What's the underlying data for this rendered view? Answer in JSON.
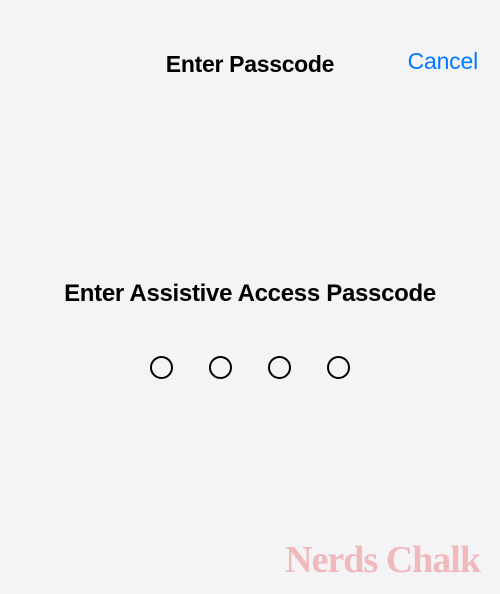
{
  "navbar": {
    "title": "Enter Passcode",
    "cancel_label": "Cancel"
  },
  "content": {
    "prompt": "Enter Assistive Access Passcode",
    "passcode_length": 4,
    "filled_count": 0
  },
  "watermark": {
    "text": "Nerds Chalk"
  },
  "colors": {
    "background": "#f4f3f6",
    "accent": "#007aff",
    "text": "#000000",
    "watermark": "rgba(236, 138, 142, 0.55)"
  }
}
